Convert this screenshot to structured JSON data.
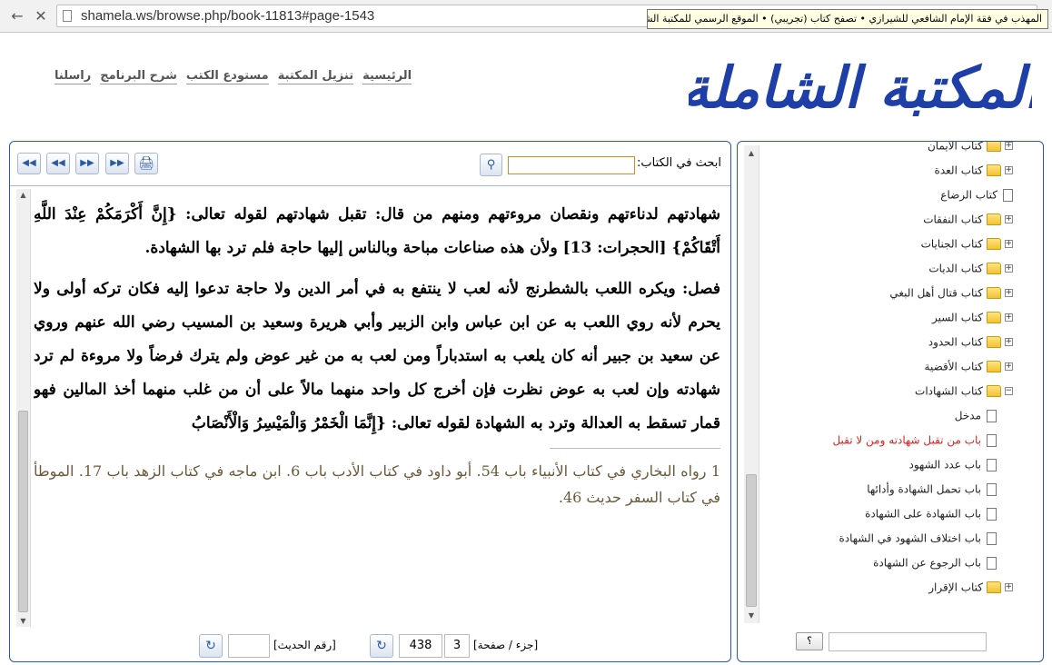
{
  "browser": {
    "url": "shamela.ws/browse.php/book-11813#page-1543",
    "tooltip": "المهذب في فقة الإمام الشافعي للشيرازي • تصفح كتاب (تجريبي) • الموقع الرسمي للمكتبة الشاملة"
  },
  "header": {
    "logo_text": "المكتبة الشاملة",
    "menu": [
      "الرئيسية",
      "تنزيل المكتبة",
      "مستودع الكتب",
      "شرح البرنامج",
      "راسلنا"
    ]
  },
  "viewer": {
    "search_label": "ابحث في الكتاب:",
    "search_value": "",
    "paragraphs": [
      "شهادتهم لدناءتهم ونقصان مروءتهم ومنهم من قال: تقبل شهادتهم لقوله تعالى: {إِنَّ أَكْرَمَكُمْ عِنْدَ اللَّهِ أَتْقَاكُمْ} [الحجرات: 13] ولأن هذه صناعات مباحة وبالناس إليها حاجة فلم ترد بها الشهادة.",
      "فصل: ويكره اللعب بالشطرنج لأنه لعب لا ينتفع به في أمر الدين ولا حاجة تدعوا إليه فكان تركه أولى ولا يحرم لأنه روي اللعب به عن ابن عباس وابن الزبير وأبي هريرة وسعيد بن المسيب رضي الله عنهم وروي عن سعيد بن جبير أنه كان يلعب به استدباراً ومن لعب به من غير عوض ولم يترك فرضاً ولا مروءة لم ترد شهادته وإن لعب به عوض نظرت فإن أخرج كل واحد منهما مالاً على أن من غلب منهما أخذ المالين فهو قمار تسقط به العدالة وترد به الشهادة لقوله تعالى: {إِنَّمَا الْخَمْرُ وَالْمَيْسِرُ وَالْأَنْصَابُ"
    ],
    "footnote": "1 رواه البخاري في كتاب الأنبياء باب 54. أبو داود في كتاب الأدب باب 6. ابن ماجه في كتاب الزهد باب 17. الموطأ في كتاب السفر حديث 46.",
    "part_page_label": "[جزء / صفحة]",
    "part": "3",
    "page": "438",
    "hadith_label": "[رقم الحديث]",
    "hadith_value": ""
  },
  "toc": {
    "items": [
      {
        "label": "كتاب الأيمان",
        "type": "folder",
        "state": "collapsed",
        "level": 0
      },
      {
        "label": "كتاب العدة",
        "type": "folder",
        "state": "collapsed",
        "level": 0
      },
      {
        "label": "كتاب الرضاع",
        "type": "doc",
        "state": "",
        "level": 0
      },
      {
        "label": "كتاب النفقات",
        "type": "folder",
        "state": "collapsed",
        "level": 0
      },
      {
        "label": "كتاب الجنايات",
        "type": "folder",
        "state": "collapsed",
        "level": 0
      },
      {
        "label": "كتاب الديات",
        "type": "folder",
        "state": "collapsed",
        "level": 0
      },
      {
        "label": "كتاب قتال أهل البغي",
        "type": "folder",
        "state": "collapsed",
        "level": 0
      },
      {
        "label": "كتاب السير",
        "type": "folder",
        "state": "collapsed",
        "level": 0
      },
      {
        "label": "كتاب الحدود",
        "type": "folder",
        "state": "collapsed",
        "level": 0
      },
      {
        "label": "كتاب الأقضية",
        "type": "folder",
        "state": "collapsed",
        "level": 0
      },
      {
        "label": "كتاب الشهادات",
        "type": "folder",
        "state": "expanded",
        "level": 0
      },
      {
        "label": "مدخل",
        "type": "doc",
        "state": "",
        "level": 1
      },
      {
        "label": "باب من تقبل شهادته ومن لا تقبل",
        "type": "doc",
        "state": "active",
        "level": 1
      },
      {
        "label": "باب عدد الشهود",
        "type": "doc",
        "state": "",
        "level": 1
      },
      {
        "label": "باب تحمل الشهادة وأدائها",
        "type": "doc",
        "state": "",
        "level": 1
      },
      {
        "label": "باب الشهادة على الشهادة",
        "type": "doc",
        "state": "",
        "level": 1
      },
      {
        "label": "باب اختلاف الشهود في الشهادة",
        "type": "doc",
        "state": "",
        "level": 1
      },
      {
        "label": "باب الرجوع عن الشهادة",
        "type": "doc",
        "state": "",
        "level": 1
      },
      {
        "label": "كتاب الإقرار",
        "type": "folder",
        "state": "collapsed",
        "level": 0
      }
    ],
    "help_label": "؟",
    "help_value": ""
  },
  "colors": {
    "panel_border": "#2a5aa0",
    "active_item": "#e0201f",
    "footnote_text": "#6a5a3a",
    "logo_blue": "#1f3fa8"
  },
  "icons": [
    "back-icon",
    "close-icon",
    "page-icon",
    "first-page-icon",
    "prev-page-icon",
    "next-page-icon",
    "last-page-icon",
    "print-icon",
    "search-icon",
    "go-icon",
    "folder-icon",
    "doc-icon",
    "expand-icon",
    "collapse-icon"
  ]
}
